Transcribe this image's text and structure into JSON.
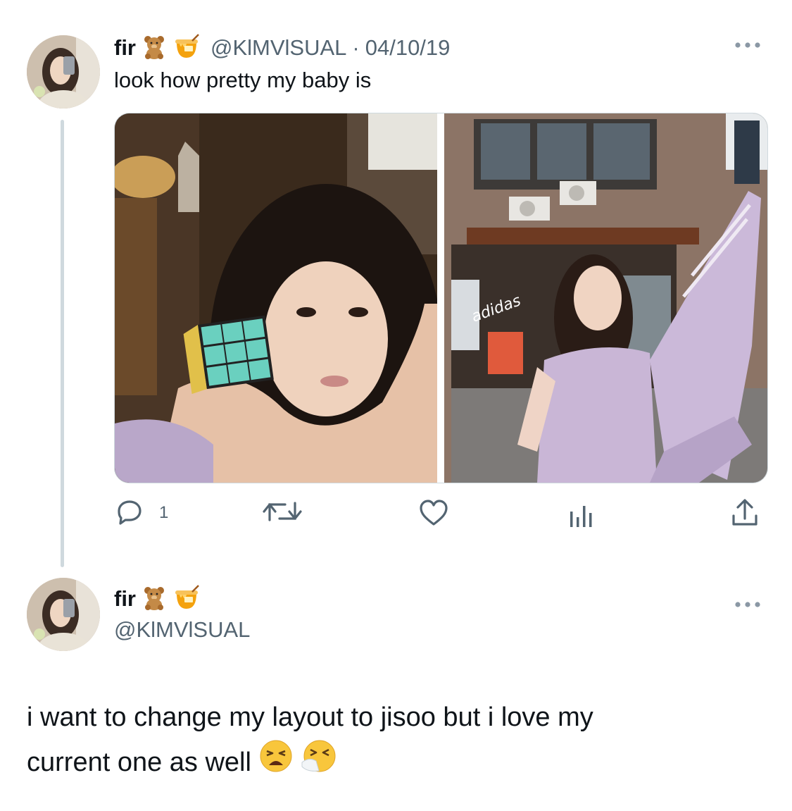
{
  "tweet1": {
    "display_name": "fir",
    "name_emojis": [
      "teddy-bear-emoji",
      "honey-pot-emoji"
    ],
    "handle": "@KlMVlSUAL",
    "separator": "·",
    "date": "04/10/19",
    "text": "look how pretty my baby is",
    "media_watermark": "adidas",
    "actions": {
      "reply_count": "1",
      "retweet_count": "",
      "like_count": "",
      "views_count": ""
    }
  },
  "tweet2": {
    "display_name": "fir",
    "name_emojis": [
      "teddy-bear-emoji",
      "honey-pot-emoji"
    ],
    "handle": "@KlMVlSUAL",
    "text_line1": "i want to change my layout to jisoo but i love my",
    "text_line2": "current one as well",
    "text_emojis": [
      "weary-face-emoji",
      "sneezing-face-emoji"
    ]
  },
  "colors": {
    "text_primary": "#0f1419",
    "text_secondary": "#536471",
    "thread_line": "#cfd9de"
  }
}
